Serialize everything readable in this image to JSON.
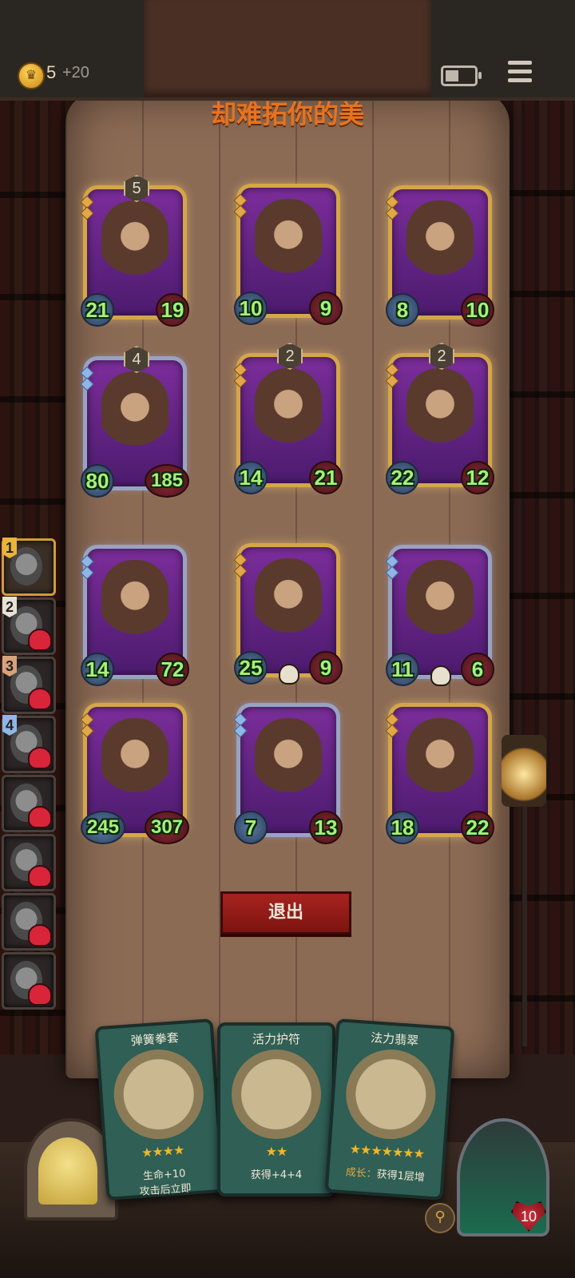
{
  "header": {
    "coins": "5",
    "coin_bonus": "+20",
    "icons": {
      "coin": "coin-icon",
      "battery": "battery-icon",
      "menu": "menu-icon"
    }
  },
  "title": "却难拓你的美",
  "board": [
    {
      "tier": "5",
      "atk": "21",
      "hp": "19",
      "frame": "gold"
    },
    {
      "tier": "",
      "atk": "10",
      "hp": "9",
      "frame": "gold"
    },
    {
      "tier": "",
      "atk": "8",
      "hp": "10",
      "frame": "gold"
    },
    {
      "tier": "4",
      "atk": "80",
      "hp": "185",
      "frame": "silver"
    },
    {
      "tier": "2",
      "atk": "14",
      "hp": "21",
      "frame": "gold"
    },
    {
      "tier": "2",
      "atk": "22",
      "hp": "12",
      "frame": "gold"
    },
    {
      "tier": "",
      "atk": "14",
      "hp": "72",
      "frame": "silver"
    },
    {
      "tier": "",
      "atk": "25",
      "hp": "9",
      "frame": "gold"
    },
    {
      "tier": "",
      "atk": "11",
      "hp": "6",
      "frame": "silver"
    },
    {
      "tier": "",
      "atk": "245",
      "hp": "307",
      "frame": "gold"
    },
    {
      "tier": "",
      "atk": "7",
      "hp": "13",
      "frame": "silver"
    },
    {
      "tier": "",
      "atk": "18",
      "hp": "22",
      "frame": "gold"
    }
  ],
  "roster": [
    "1",
    "2",
    "3",
    "4",
    "",
    "",
    "",
    ""
  ],
  "exit_label": "退出",
  "shop": [
    {
      "title": "弹簧拳套",
      "stars": "★★★★",
      "desc_line1": "生命+10",
      "desc_line2": "攻击后立即"
    },
    {
      "title": "活力护符",
      "stars": "★★",
      "desc_line1": "获得+4+4",
      "desc_line2": ""
    },
    {
      "title": "法力翡翠",
      "stars": "★★★★★★★",
      "desc_label": "成长：",
      "desc_line1": "获得1层增",
      "desc_line2": ""
    }
  ],
  "hero": {
    "hp": "10"
  },
  "colors": {
    "title": "#e8731e",
    "exit": "#a8231e",
    "stat_text": "#a7f07a"
  }
}
